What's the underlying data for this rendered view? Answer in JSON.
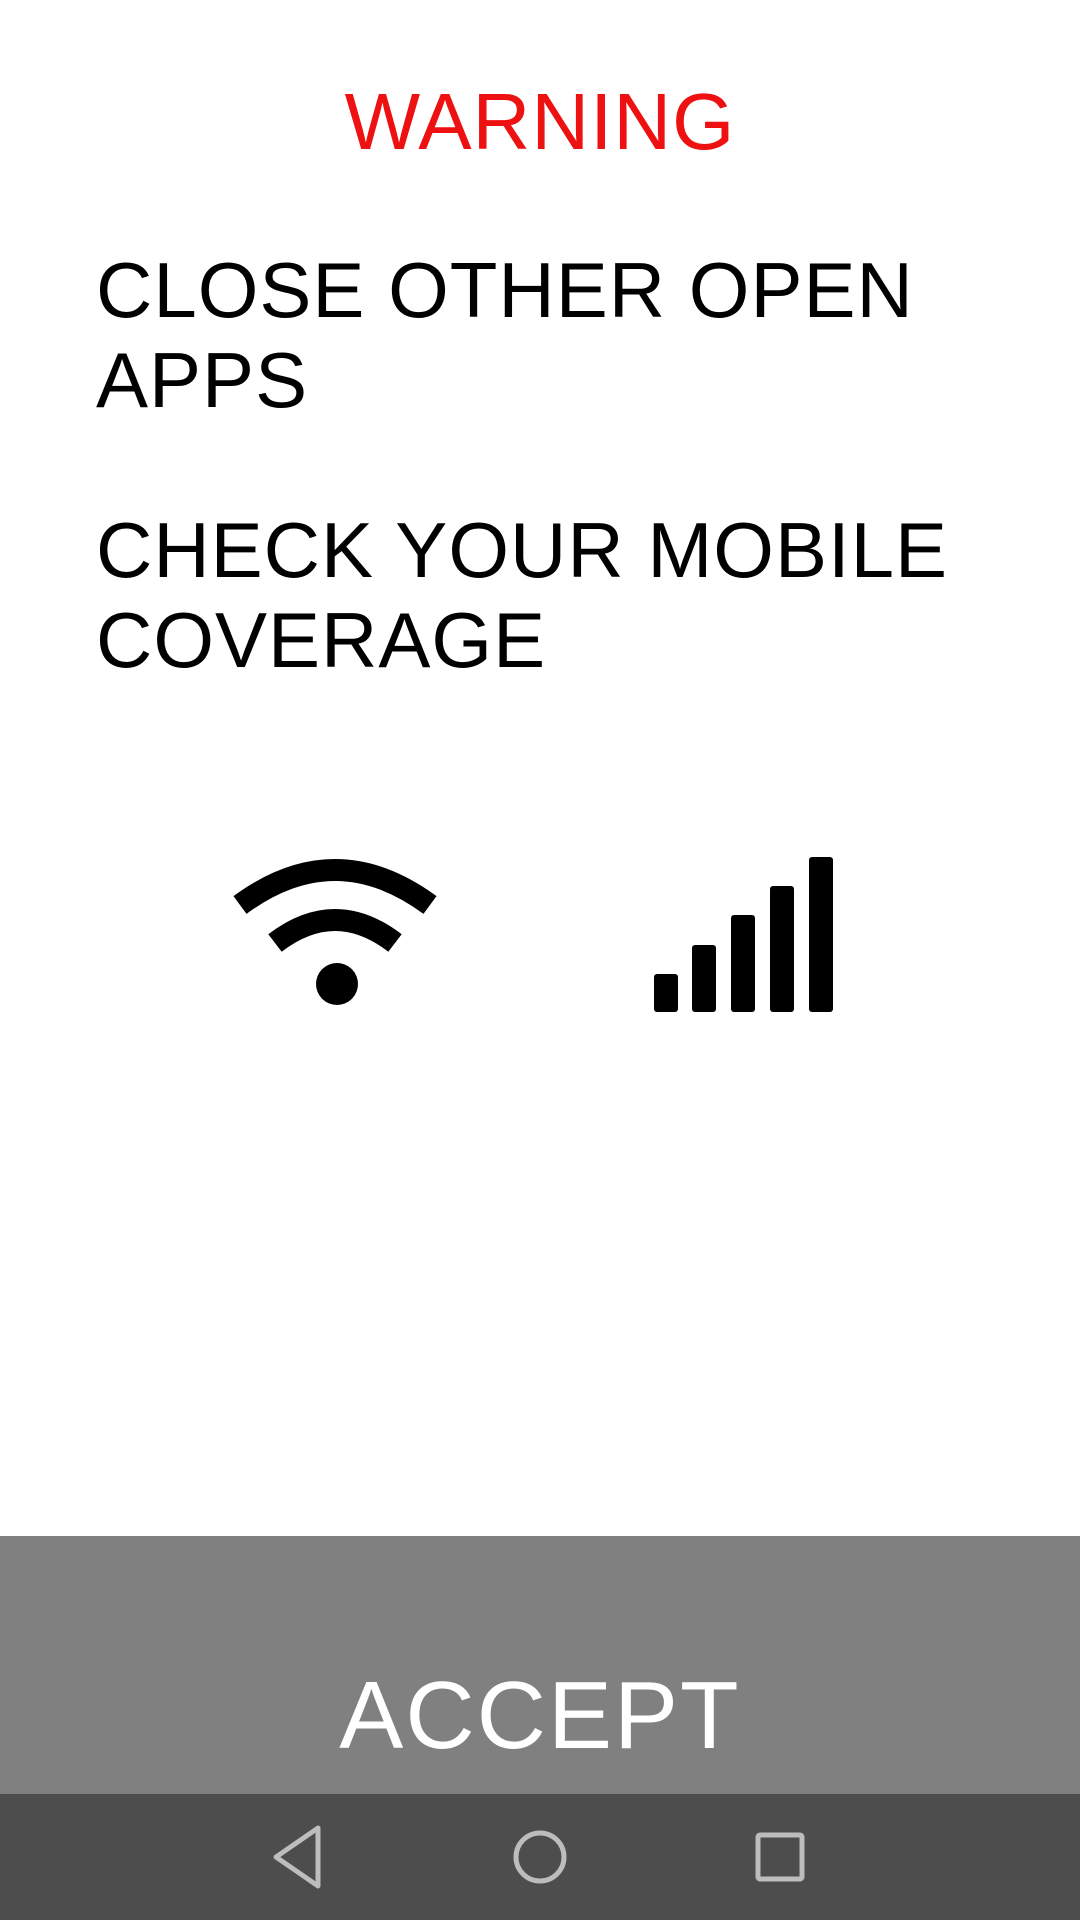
{
  "header": {
    "title": "WARNING"
  },
  "messages": [
    "CLOSE OTHER OPEN APPS",
    "CHECK YOUR MOBILE COVERAGE"
  ],
  "icons": {
    "wifi": "wifi-icon",
    "signal": "cellular-signal-icon"
  },
  "accept_button": {
    "label": "ACCEPT"
  },
  "navigation_bar": {
    "back": "back-icon",
    "home": "home-icon",
    "recents": "recents-icon"
  },
  "colors": {
    "title": "#ee1111",
    "text": "#000000",
    "accept_background": "#808080",
    "accept_text": "#ffffff",
    "navbar_background": "#4d4d4d",
    "nav_icons": "#bdbdbd"
  }
}
